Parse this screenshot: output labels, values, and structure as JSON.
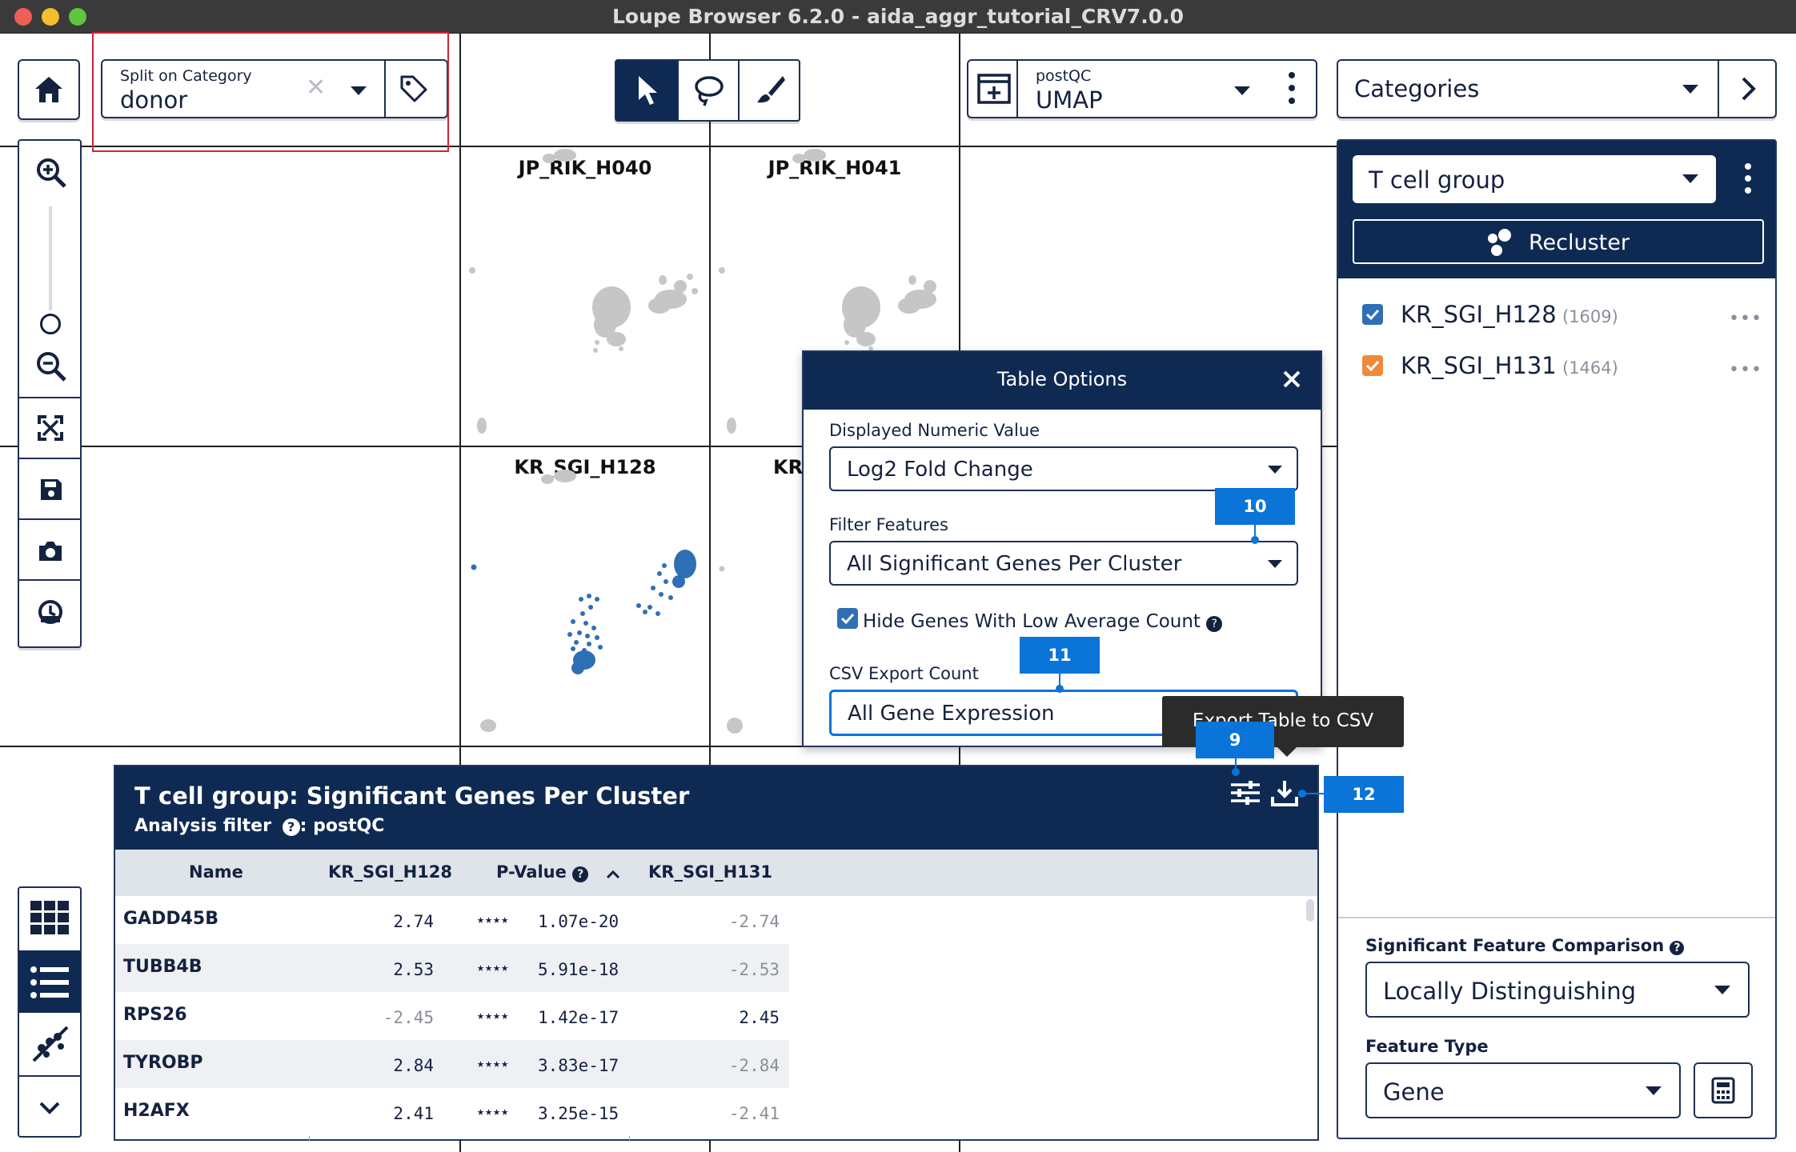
{
  "window": {
    "title": "Loupe Browser 6.2.0 - aida_aggr_tutorial_CRV7.0.0"
  },
  "toolbar": {
    "split_label": "Split on Category",
    "split_value": "donor",
    "projection_label": "postQC",
    "projection_value": "UMAP",
    "categories_select": "Categories"
  },
  "panels": [
    {
      "label": "JP_RIK_H040"
    },
    {
      "label": "JP_RIK_H041"
    },
    {
      "label": "KR_SGI_H128"
    },
    {
      "label": "KR_"
    }
  ],
  "right_panel": {
    "group_select": "T cell group",
    "recluster_label": "Recluster",
    "clusters": [
      {
        "name": "KR_SGI_H128",
        "count": "(1609)",
        "color": "#2f6fb5"
      },
      {
        "name": "KR_SGI_H131",
        "count": "(1464)",
        "color": "#f08a3a"
      }
    ],
    "comparison_label": "Significant Feature Comparison",
    "comparison_value": "Locally Distinguishing",
    "feature_type_label": "Feature Type",
    "feature_type_value": "Gene"
  },
  "dialog": {
    "title": "Table Options",
    "numeric_label": "Displayed Numeric Value",
    "numeric_value": "Log2 Fold Change",
    "filter_label": "Filter Features",
    "filter_value": "All Significant Genes Per Cluster",
    "hide_label": "Hide Genes With Low Average Count",
    "csv_label": "CSV Export Count",
    "csv_value": "All Gene Expression"
  },
  "tooltip": {
    "text": "Export Table to CSV"
  },
  "annotations": {
    "b9": "9",
    "b10": "10",
    "b11": "11",
    "b12": "12"
  },
  "table": {
    "title": "T cell group: Significant Genes Per Cluster",
    "filter_label": "Analysis filter",
    "filter_value": ": postQC",
    "columns": [
      "Name",
      "KR_SGI_H128",
      "P-Value",
      "KR_SGI_H131"
    ],
    "rows": [
      {
        "name": "GADD45B",
        "v1": "2.74",
        "stars": "★★★★",
        "p": "1.07e-20",
        "v2": "-2.74"
      },
      {
        "name": "TUBB4B",
        "v1": "2.53",
        "stars": "★★★★",
        "p": "5.91e-18",
        "v2": "-2.53"
      },
      {
        "name": "RPS26",
        "v1": "-2.45",
        "stars": "★★★★",
        "p": "1.42e-17",
        "v2": "2.45"
      },
      {
        "name": "TYROBP",
        "v1": "2.84",
        "stars": "★★★★",
        "p": "3.83e-17",
        "v2": "-2.84"
      },
      {
        "name": "H2AFX",
        "v1": "2.41",
        "stars": "★★★★",
        "p": "3.25e-15",
        "v2": "-2.41"
      }
    ]
  },
  "colors": {
    "navy": "#0f2a52",
    "accent_blue": "#0a74d8",
    "highlight_red": "#d0243a",
    "cluster_blue": "#2f6fb5",
    "cluster_orange": "#f08a3a"
  }
}
